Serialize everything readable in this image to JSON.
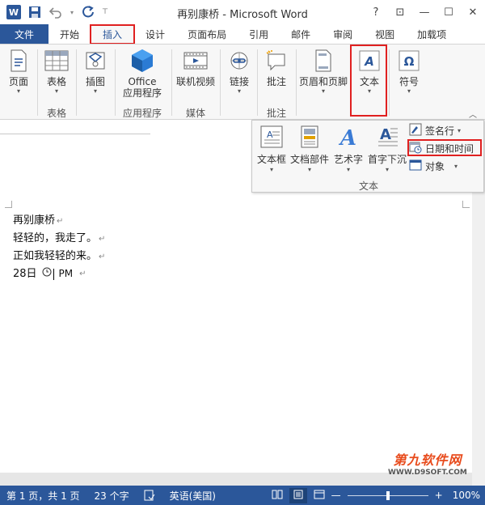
{
  "title": "再别康桥 - Microsoft Word",
  "window_controls": {
    "help": "?",
    "ribbon_display": "⊡",
    "minimize": "—",
    "maximize": "☐",
    "close": "✕"
  },
  "qat": {
    "word_logo": "W"
  },
  "tabs": [
    "文件",
    "开始",
    "插入",
    "设计",
    "页面布局",
    "引用",
    "邮件",
    "审阅",
    "视图",
    "加载项"
  ],
  "ribbon": {
    "buttons": {
      "pages": "页面",
      "table": "表格",
      "illustrations": "插图",
      "office_line1": "Office",
      "office_line2": "应用程序",
      "online_video": "联机视频",
      "links": "链接",
      "comment": "批注",
      "header_footer": "页眉和页脚",
      "text": "文本",
      "symbols": "符号"
    },
    "groups": {
      "table": "表格",
      "apps": "应用程序",
      "media": "媒体",
      "comments": "批注"
    }
  },
  "text_popup": {
    "textbox": "文本框",
    "doc_parts": "文档部件",
    "wordart": "艺术字",
    "dropcap": "首字下沉",
    "signature_line": "签名行",
    "date_time": "日期和时间",
    "object": "对象",
    "group_label": "文本"
  },
  "document": {
    "lines": [
      "再别康桥",
      "轻轻的，我走了。",
      "正如我轻轻的来。"
    ],
    "date_line_day": "28日",
    "date_line_pm": "PM"
  },
  "watermark": {
    "line1": "第九软件网",
    "line2": "WWW.D9SOFT.COM"
  },
  "status": {
    "page": "第 1 页，共 1 页",
    "words": "23 个字",
    "language": "英语(美国)",
    "zoom": "100%",
    "zoom_level_percent": 100
  },
  "colors": {
    "accent": "#2b579a",
    "highlight": "#e02020"
  }
}
